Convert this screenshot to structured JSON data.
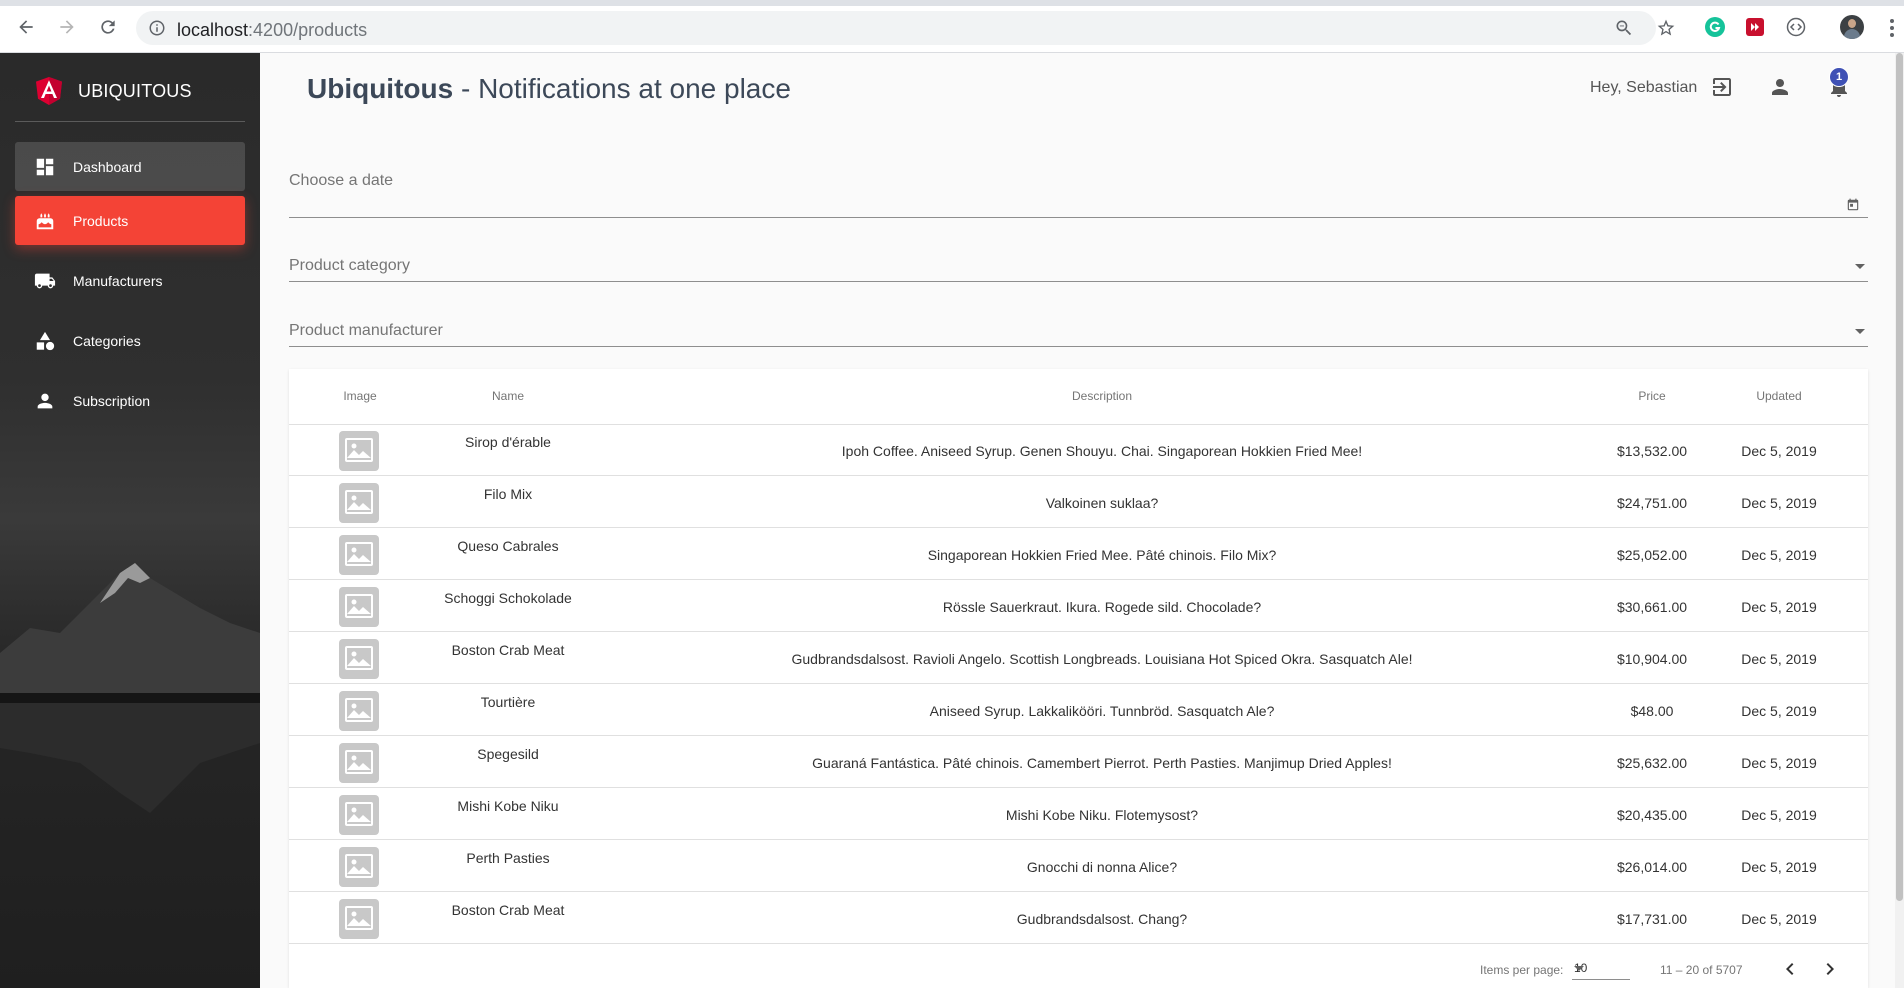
{
  "browser": {
    "url_host": "localhost",
    "url_path": ":4200/products"
  },
  "sidebar": {
    "brand": "UBIQUITOUS",
    "items": [
      {
        "label": "Dashboard",
        "icon": "dashboard-icon"
      },
      {
        "label": "Products",
        "icon": "cake-icon"
      },
      {
        "label": "Manufacturers",
        "icon": "truck-icon"
      },
      {
        "label": "Categories",
        "icon": "shapes-icon"
      },
      {
        "label": "Subscription",
        "icon": "person-icon"
      }
    ],
    "active_item": "Products"
  },
  "header": {
    "title_bold": "Ubiquitous",
    "title_rest": " - Notifications at one place",
    "greeting": "Hey, Sebastian",
    "notification_count": "1"
  },
  "filters": {
    "date_label": "Choose a date",
    "category_label": "Product category",
    "manufacturer_label": "Product manufacturer"
  },
  "table": {
    "columns": [
      "Image",
      "Name",
      "Description",
      "Price",
      "Updated"
    ],
    "rows": [
      {
        "name": "Sirop d'érable",
        "description": "Ipoh Coffee. Aniseed Syrup. Genen Shouyu. Chai. Singaporean Hokkien Fried Mee!",
        "price": "$13,532.00",
        "updated": "Dec 5, 2019"
      },
      {
        "name": "Filo Mix",
        "description": "Valkoinen suklaa?",
        "price": "$24,751.00",
        "updated": "Dec 5, 2019"
      },
      {
        "name": "Queso Cabrales",
        "description": "Singaporean Hokkien Fried Mee. Pâté chinois. Filo Mix?",
        "price": "$25,052.00",
        "updated": "Dec 5, 2019"
      },
      {
        "name": "Schoggi Schokolade",
        "description": "Rössle Sauerkraut. Ikura. Rogede sild. Chocolade?",
        "price": "$30,661.00",
        "updated": "Dec 5, 2019"
      },
      {
        "name": "Boston Crab Meat",
        "description": "Gudbrandsdalsost. Ravioli Angelo. Scottish Longbreads. Louisiana Hot Spiced Okra. Sasquatch Ale!",
        "price": "$10,904.00",
        "updated": "Dec 5, 2019"
      },
      {
        "name": "Tourtière",
        "description": "Aniseed Syrup. Lakkalikööri. Tunnbröd. Sasquatch Ale?",
        "price": "$48.00",
        "updated": "Dec 5, 2019"
      },
      {
        "name": "Spegesild",
        "description": "Guaraná Fantástica. Pâté chinois. Camembert Pierrot. Perth Pasties. Manjimup Dried Apples!",
        "price": "$25,632.00",
        "updated": "Dec 5, 2019"
      },
      {
        "name": "Mishi Kobe Niku",
        "description": "Mishi Kobe Niku. Flotemysost?",
        "price": "$20,435.00",
        "updated": "Dec 5, 2019"
      },
      {
        "name": "Perth Pasties",
        "description": "Gnocchi di nonna Alice?",
        "price": "$26,014.00",
        "updated": "Dec 5, 2019"
      },
      {
        "name": "Boston Crab Meat",
        "description": "Gudbrandsdalsost. Chang?",
        "price": "$17,731.00",
        "updated": "Dec 5, 2019"
      }
    ]
  },
  "paginator": {
    "items_per_page_label": "Items per page:",
    "page_size": "10",
    "range": "11 – 20 of 5707"
  },
  "colors": {
    "accent": "#f44336",
    "badge": "#3f51b5"
  }
}
